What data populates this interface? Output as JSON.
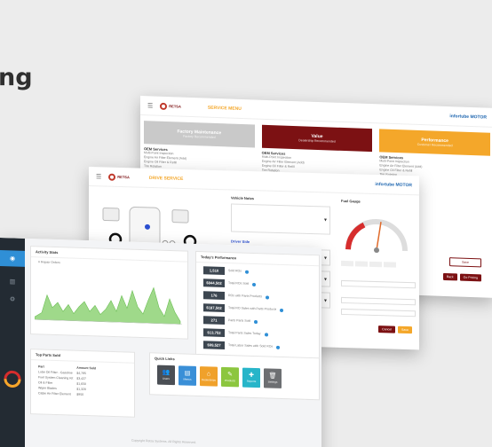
{
  "heading": "ng",
  "colors": {
    "brand_red": "#7c1113",
    "accent_orange": "#f4a72a",
    "grey_banner": "#c9c9c9",
    "chart_green": "#9fd98a",
    "sidebar": "#232b33"
  },
  "back_window": {
    "logo": "RETSA",
    "title": "SERVICE MENU",
    "brand_logo": "infortube MOTOR",
    "banners": [
      {
        "title": "Factory Maintenance",
        "sub": "Factory Recommended",
        "color": "#c9c9c9"
      },
      {
        "title": "Value",
        "sub": "Dealership Recommended",
        "color": "#7c1113"
      },
      {
        "title": "Performance",
        "sub": "Customer Recommended",
        "color": "#f4a72a"
      }
    ],
    "col_heading": "OEM Services",
    "lines": [
      "Multi-Point Inspection",
      "Engine Air Filter Element (Add)",
      "Engine Oil Filter & Refill",
      "Tire Rotation"
    ],
    "buttons": [
      "Save",
      "Back",
      "Go Pricing"
    ]
  },
  "mid_window": {
    "logo": "RETSA",
    "title": "DRIVE SERVICE",
    "brand_logo": "infortube MOTOR",
    "fields": [
      "Vehicle Notes",
      "Driver Side",
      "Fuel Gauge"
    ],
    "buttons": [
      "Cancel",
      "Save"
    ]
  },
  "front_window": {
    "activity_title": "Activity Stats",
    "chart_legend": "# Repair Orders",
    "performance_title": "Today's Performance",
    "kpis": [
      {
        "value": "1,510",
        "label": "Sold ROs"
      },
      {
        "value": "$844,502",
        "label": "Total ROs Sold"
      },
      {
        "value": "176",
        "label": "ROs with Parts Products"
      },
      {
        "value": "$187,502",
        "label": "Total RO Sales with Parts Products"
      },
      {
        "value": "271",
        "label": "Parts Parts Sold"
      },
      {
        "value": "$13,752",
        "label": "Total Parts Sales Today"
      },
      {
        "value": "$99,527",
        "label": "Total Labor Sales with Sold ROs"
      }
    ],
    "top_parts_title": "Top Parts Sold",
    "table_headers": [
      "Part",
      "Amount Sold"
    ],
    "table_rows": [
      [
        "Lube Oil Filter - Gasoline",
        "$4,785"
      ],
      [
        "Fuel System Cleaning Kit",
        "$3,427"
      ],
      [
        "Oil & Filter",
        "$1,650"
      ],
      [
        "Wiper Blades",
        "$1,320"
      ],
      [
        "Cabin Air Filter Element",
        "$950"
      ]
    ],
    "quick_links_title": "Quick Links",
    "quick_links": [
      {
        "label": "Users",
        "icon": "users-icon",
        "color": "#4b4f55"
      },
      {
        "label": "Menus",
        "icon": "menu-icon",
        "color": "#3a8fd7"
      },
      {
        "label": "Dealerships",
        "icon": "building-icon",
        "color": "#f0a12b"
      },
      {
        "label": "Products",
        "icon": "pencil-icon",
        "color": "#8cc63f"
      },
      {
        "label": "Reports",
        "icon": "plus-icon",
        "color": "#27b5c9"
      },
      {
        "label": "Settings",
        "icon": "trash-icon",
        "color": "#6d6f72"
      }
    ],
    "sidebar_items": [
      "Dashboard",
      "Reports",
      "Settings"
    ],
    "footer": "Copyright Retsa Systems. All Rights Reserved."
  }
}
